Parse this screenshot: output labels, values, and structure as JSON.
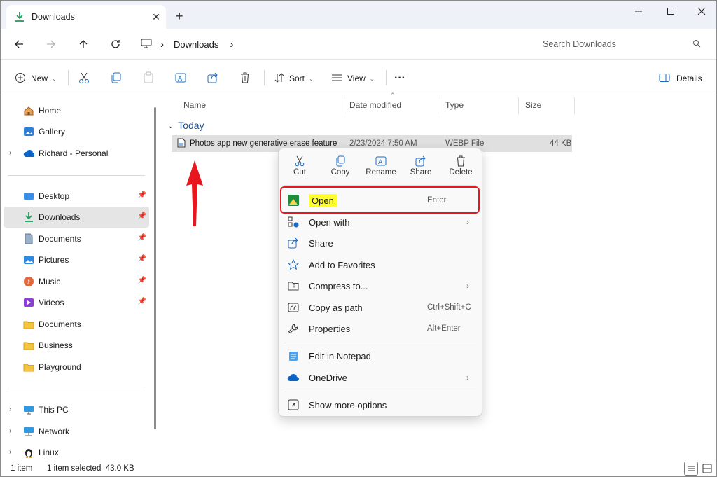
{
  "window": {
    "tab_title": "Downloads",
    "tab_close": "✕",
    "new_tab": "+"
  },
  "address": {
    "crumb_sep": "›",
    "crumb": "Downloads",
    "search_placeholder": "Search Downloads"
  },
  "toolbar": {
    "new_label": "New",
    "sort_label": "Sort",
    "view_label": "View",
    "more_label": "···",
    "details_label": "Details"
  },
  "sidebar": {
    "top": [
      {
        "label": "Home"
      },
      {
        "label": "Gallery"
      },
      {
        "label": "Richard - Personal"
      }
    ],
    "pinned": [
      {
        "label": "Desktop"
      },
      {
        "label": "Downloads"
      },
      {
        "label": "Documents"
      },
      {
        "label": "Pictures"
      },
      {
        "label": "Music"
      },
      {
        "label": "Videos"
      },
      {
        "label": "Documents"
      },
      {
        "label": "Business"
      },
      {
        "label": "Playground"
      }
    ],
    "bottom": [
      {
        "label": "This PC"
      },
      {
        "label": "Network"
      },
      {
        "label": "Linux"
      }
    ]
  },
  "columns": [
    "Name",
    "Date modified",
    "Type",
    "Size"
  ],
  "group_label": "Today",
  "file": {
    "name": "Photos app new generative erase feature",
    "date": "2/23/2024 7:50 AM",
    "type": "WEBP File",
    "size": "44 KB"
  },
  "context_menu": {
    "quick_actions": [
      "Cut",
      "Copy",
      "Rename",
      "Share",
      "Delete"
    ],
    "items": [
      {
        "label": "Open",
        "shortcut": "Enter"
      },
      {
        "label": "Open with",
        "shortcut": ""
      },
      {
        "label": "Share",
        "shortcut": ""
      },
      {
        "label": "Add to Favorites",
        "shortcut": ""
      },
      {
        "label": "Compress to...",
        "shortcut": ""
      },
      {
        "label": "Copy as path",
        "shortcut": "Ctrl+Shift+C"
      },
      {
        "label": "Properties",
        "shortcut": "Alt+Enter"
      },
      {
        "label": "Edit in Notepad",
        "shortcut": ""
      },
      {
        "label": "OneDrive",
        "shortcut": ""
      },
      {
        "label": "Show more options",
        "shortcut": ""
      }
    ]
  },
  "status": {
    "count": "1 item",
    "selected": "1 item selected  43.0 KB"
  },
  "colors": {
    "accent": "#0067c0",
    "highlight_box": "#e8171f",
    "highlight_fill": "#ffff2e"
  }
}
